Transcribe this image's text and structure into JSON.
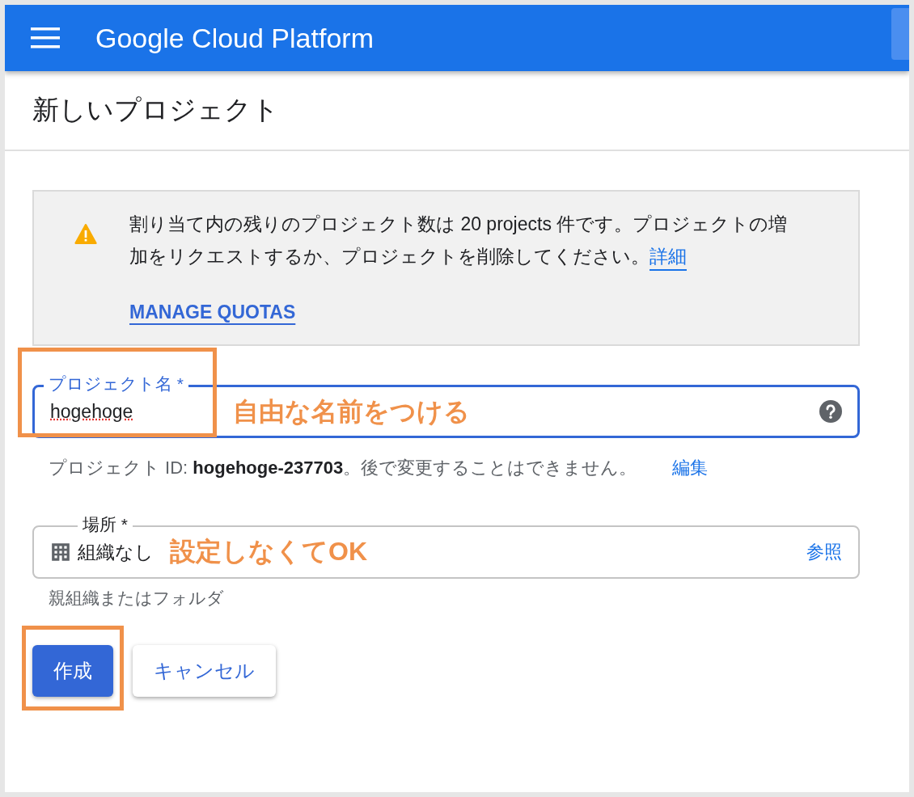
{
  "header": {
    "title": "Google Cloud Platform"
  },
  "page_title": "新しいプロジェクト",
  "notice": {
    "message": "割り当て内の残りのプロジェクト数は 20 projects 件です。プロジェクトの増加をリクエストするか、プロジェクトを削除してください。",
    "details_link": "詳細",
    "manage_link": "MANAGE QUOTAS"
  },
  "project_name_field": {
    "label": "プロジェクト名 *",
    "value": "hogehoge",
    "focused": true
  },
  "project_id_hint": "プロジェクト ID: **hogehoge-237703**。後で変更することはできません。",
  "edit_link": "編集",
  "location_field": {
    "label": "場所 *",
    "value": "組織なし",
    "browse_link": "参照",
    "hint": "親組織またはフォルダ"
  },
  "buttons": [
    {
      "label": "作成",
      "kind": "primary"
    },
    {
      "label": "キャンセル",
      "kind": "secondary"
    }
  ],
  "annotations": [
    "自由な名前をつける",
    "設定しなくてOK"
  ]
}
